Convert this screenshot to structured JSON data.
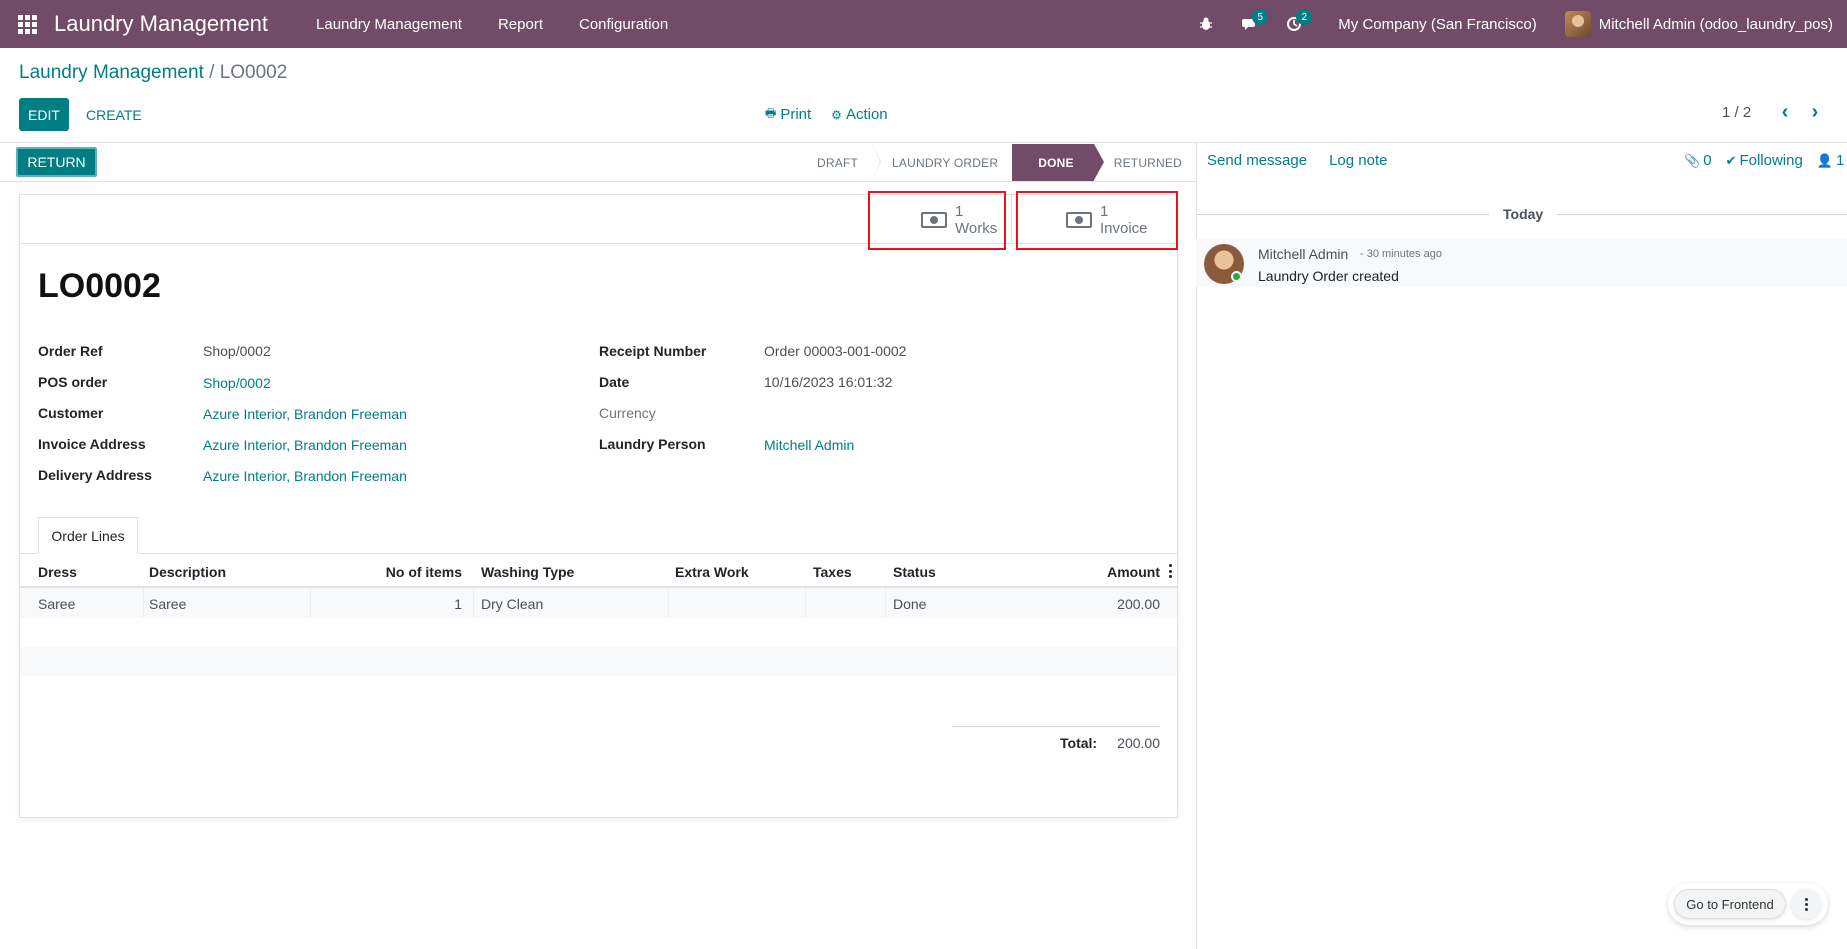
{
  "navbar": {
    "brand": "Laundry Management",
    "menu": [
      "Laundry Management",
      "Report",
      "Configuration"
    ],
    "messages_badge": "5",
    "activities_badge": "2",
    "company": "My Company (San Francisco)",
    "user": "Mitchell Admin (odoo_laundry_pos)",
    "bg_color": "#714B67"
  },
  "breadcrumb": {
    "parent": "Laundry Management",
    "separator": "/",
    "current": "LO0002"
  },
  "control": {
    "edit": "EDIT",
    "create": "CREATE",
    "print": "Print",
    "action": "Action",
    "pager": "1 / 2"
  },
  "statusbar": {
    "return_button": "RETURN",
    "stages": [
      "DRAFT",
      "LAUNDRY ORDER",
      "DONE",
      "RETURNED"
    ],
    "active_stage": "DONE"
  },
  "smart_buttons": {
    "works_count": "1",
    "works_label": "Works",
    "invoice_count": "1",
    "invoice_label": "Invoice"
  },
  "form": {
    "name": "LO0002",
    "left_fields": [
      {
        "label": "Order Ref",
        "value": "Shop/0002"
      },
      {
        "label": "POS order",
        "value": "Shop/0002"
      },
      {
        "label": "Customer",
        "value": "Azure Interior, Brandon Freeman"
      },
      {
        "label": "Invoice Address",
        "value": "Azure Interior, Brandon Freeman"
      },
      {
        "label": "Delivery Address",
        "value": "Azure Interior, Brandon Freeman"
      }
    ],
    "right_fields": [
      {
        "label": "Receipt Number",
        "value": "Order 00003-001-0002"
      },
      {
        "label": "Date",
        "value": "10/16/2023 16:01:32"
      },
      {
        "label": "Currency",
        "value": ""
      },
      {
        "label": "Laundry Person",
        "value": "Mitchell Admin"
      }
    ]
  },
  "tabs": {
    "order_lines": "Order Lines"
  },
  "table": {
    "headers": [
      "Dress",
      "Description",
      "No of items",
      "Washing Type",
      "Extra Work",
      "Taxes",
      "Status",
      "Amount"
    ],
    "rows": [
      {
        "dress": "Saree",
        "description": "Saree",
        "items": "1",
        "washing": "Dry Clean",
        "extra": "",
        "taxes": "",
        "status": "Done",
        "amount": "200.00"
      }
    ],
    "total_label": "Total:",
    "total_value": "200.00"
  },
  "chatter": {
    "send_message": "Send message",
    "log_note": "Log note",
    "attachments": "0",
    "following": "Following",
    "followers": "1",
    "today": "Today",
    "message": {
      "author": "Mitchell Admin",
      "date": "- 30 minutes ago",
      "body": "Laundry Order created"
    }
  },
  "floating": {
    "go_frontend": "Go to Frontend"
  }
}
